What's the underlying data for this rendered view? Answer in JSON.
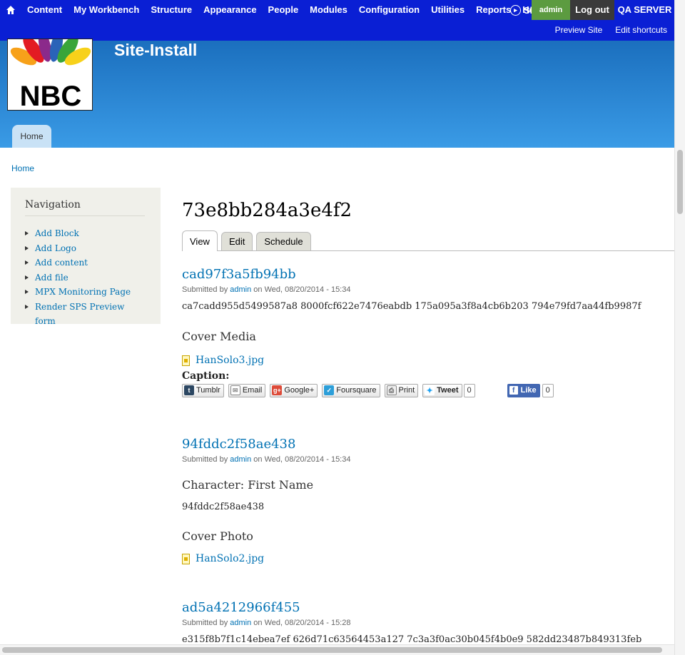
{
  "toolbar": {
    "menu": [
      "Content",
      "My Workbench",
      "Structure",
      "Appearance",
      "People",
      "Modules",
      "Configuration",
      "Utilities",
      "Reports",
      "Help"
    ],
    "shortcuts_toggle": "Shortcuts",
    "account_label": "admin",
    "logout_label": "Log out",
    "server_label": "QA SERVER",
    "shortcuts": [
      "Preview Site",
      "Edit shortcuts"
    ]
  },
  "header": {
    "logo_text": "NBC",
    "site_name": "Site-Install",
    "main_menu": [
      "Home"
    ]
  },
  "breadcrumb": [
    "Home"
  ],
  "sidebar": {
    "title": "Navigation",
    "items": [
      {
        "label": "Add Block",
        "collapsed": true
      },
      {
        "label": "Add Logo",
        "collapsed": false
      },
      {
        "label": "Add content",
        "collapsed": true
      },
      {
        "label": "Add file",
        "collapsed": false
      },
      {
        "label": "MPX Monitoring Page",
        "collapsed": false
      },
      {
        "label": "Render SPS Preview form",
        "collapsed": false
      }
    ]
  },
  "page": {
    "title": "73e8bb284a3e4f2",
    "tabs": [
      "View",
      "Edit",
      "Schedule"
    ]
  },
  "nodes": [
    {
      "title": "cad97f3a5fb94bb",
      "submitted_prefix": "Submitted by",
      "author": "admin",
      "date": "on Wed, 08/20/2014 - 15:34",
      "body": "ca7cadd955d5499587a8 8000fcf622e7476eabdb 175a095a3f8a4cb6b203 794e79fd7aa44fb9987f",
      "field_label": "Cover Media",
      "file": "HanSolo3.jpg",
      "caption_label": "Caption:",
      "share": {
        "tumblr": "Tumblr",
        "email": "Email",
        "google": "Google+",
        "foursquare": "Foursquare",
        "print": "Print",
        "tweet": "Tweet",
        "tweet_count": "0",
        "like": "Like",
        "like_count": "0"
      }
    },
    {
      "title": "94fddc2f58ae438",
      "submitted_prefix": "Submitted by",
      "author": "admin",
      "date": "on Wed, 08/20/2014 - 15:34",
      "field1_label": "Character: First Name",
      "field1_value": "94fddc2f58ae438",
      "field2_label": "Cover Photo",
      "file": "HanSolo2.jpg"
    },
    {
      "title": "ad5a4212966f455",
      "submitted_prefix": "Submitted by",
      "author": "admin",
      "date": "on Wed, 08/20/2014 - 15:28",
      "body": "e315f8b7f1c14ebea7ef 626d71c63564453a127 7c3a3f0ac30b045f4b0e9 582dd23487b849313feb"
    }
  ]
}
